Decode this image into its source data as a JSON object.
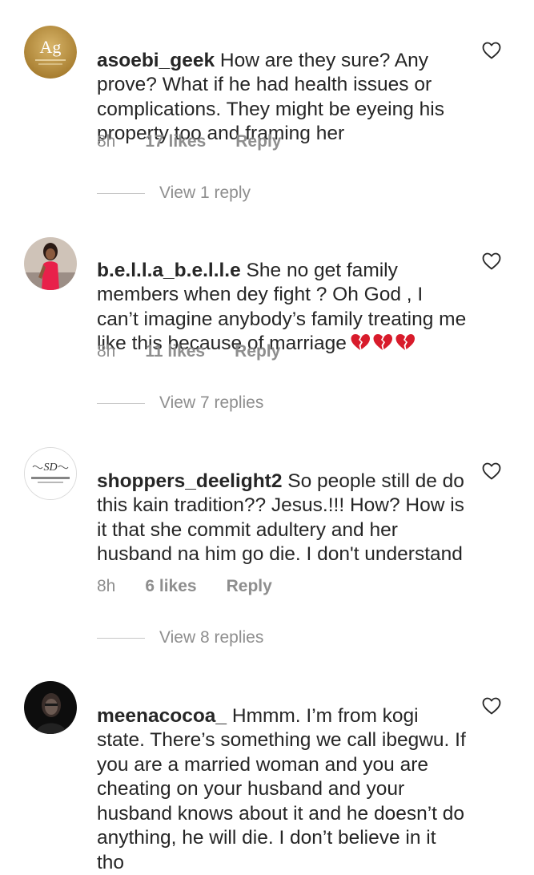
{
  "colors": {
    "text": "#262626",
    "secondary": "#8e8e8e",
    "divider": "#c7c7c7",
    "heart_emoji": "#d81b2b"
  },
  "comments": [
    {
      "avatar_icon": "asoebi-geek-logo",
      "avatar_initials": "Ag",
      "username": "asoebi_geek",
      "text": " How are they sure? Any prove? What if he had health issues or complications. They might be eyeing his property too and framing her",
      "time": "8h",
      "likes": "17 likes",
      "reply": "Reply",
      "view_replies": "View 1 reply"
    },
    {
      "avatar_icon": "profile-photo",
      "username": "b.e.l.l.a_b.e.l.l.e",
      "text": " She no get family members when dey fight ? Oh God , I can’t imagine anybody’s family treating me like this because of marriage",
      "emoji": "broken-heart-emoji x3",
      "time": "8h",
      "likes": "11 likes",
      "reply": "Reply",
      "view_replies": "View 7 replies"
    },
    {
      "avatar_icon": "shoppers-deelight-logo",
      "username": "shoppers_deelight2",
      "text": " So people still de do this kain tradition?? Jesus.!!! How? How is it that she commit adultery and her husband na him go die. I don't understand",
      "time": "8h",
      "likes": "6 likes",
      "reply": "Reply",
      "view_replies": "View 8 replies"
    },
    {
      "avatar_icon": "profile-photo",
      "username": "meenacocoa_",
      "text": " Hmmm. I’m from kogi state. There’s something we call ibegwu. If you are a married woman and you are cheating on your husband and your husband knows about it and he doesn’t do anything, he will die. I don’t believe in it tho"
    }
  ]
}
